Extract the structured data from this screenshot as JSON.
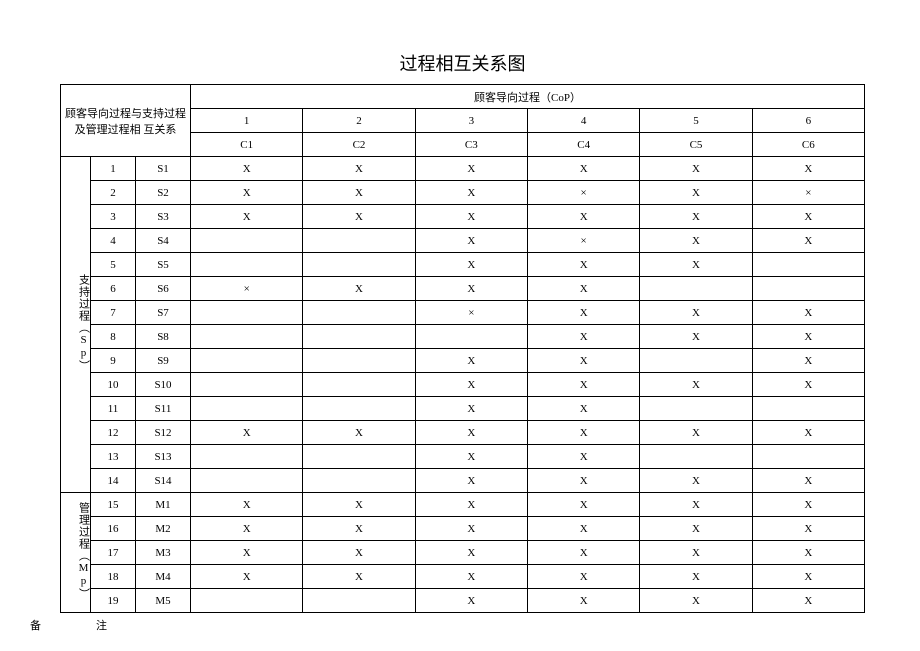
{
  "title": "过程相互关系图",
  "row_header": "顾客导向过程与支持过程及管理过程相\n互关系",
  "col_group_header": "顾客导向过程（CoP）",
  "columns": {
    "nums": [
      "1",
      "2",
      "3",
      "4",
      "5",
      "6"
    ],
    "codes": [
      "C1",
      "C2",
      "C3",
      "C4",
      "C5",
      "C6"
    ]
  },
  "groups": [
    {
      "label": "支持过程（Sp）",
      "start": 0,
      "count": 14
    },
    {
      "label": "管理过程（Mp）",
      "start": 14,
      "count": 5
    }
  ],
  "rows": [
    {
      "n": "1",
      "code": "S1",
      "c": [
        "X",
        "X",
        "X",
        "X",
        "X",
        "X"
      ]
    },
    {
      "n": "2",
      "code": "S2",
      "c": [
        "X",
        "X",
        "X",
        "×",
        "X",
        "×"
      ]
    },
    {
      "n": "3",
      "code": "S3",
      "c": [
        "X",
        "X",
        "X",
        "X",
        "X",
        "X"
      ]
    },
    {
      "n": "4",
      "code": "S4",
      "c": [
        "",
        "",
        "X",
        "×",
        "X",
        "X"
      ]
    },
    {
      "n": "5",
      "code": "S5",
      "c": [
        "",
        "",
        "X",
        "X",
        "X",
        ""
      ]
    },
    {
      "n": "6",
      "code": "S6",
      "c": [
        "×",
        "X",
        "X",
        "X",
        "",
        ""
      ]
    },
    {
      "n": "7",
      "code": "S7",
      "c": [
        "",
        "",
        "×",
        "X",
        "X",
        "X"
      ]
    },
    {
      "n": "8",
      "code": "S8",
      "c": [
        "",
        "",
        "",
        "X",
        "X",
        "X"
      ]
    },
    {
      "n": "9",
      "code": "S9",
      "c": [
        "",
        "",
        "X",
        "X",
        "",
        "X"
      ]
    },
    {
      "n": "10",
      "code": "S10",
      "c": [
        "",
        "",
        "X",
        "X",
        "X",
        "X"
      ]
    },
    {
      "n": "11",
      "code": "S11",
      "c": [
        "",
        "",
        "X",
        "X",
        "",
        ""
      ]
    },
    {
      "n": "12",
      "code": "S12",
      "c": [
        "X",
        "X",
        "X",
        "X",
        "X",
        "X"
      ]
    },
    {
      "n": "13",
      "code": "S13",
      "c": [
        "",
        "",
        "X",
        "X",
        "",
        ""
      ]
    },
    {
      "n": "14",
      "code": "S14",
      "c": [
        "",
        "",
        "X",
        "X",
        "X",
        "X"
      ]
    },
    {
      "n": "15",
      "code": "M1",
      "c": [
        "X",
        "X",
        "X",
        "X",
        "X",
        "X"
      ]
    },
    {
      "n": "16",
      "code": "M2",
      "c": [
        "X",
        "X",
        "X",
        "X",
        "X",
        "X"
      ]
    },
    {
      "n": "17",
      "code": "M3",
      "c": [
        "X",
        "X",
        "X",
        "X",
        "X",
        "X"
      ]
    },
    {
      "n": "18",
      "code": "M4",
      "c": [
        "X",
        "X",
        "X",
        "X",
        "X",
        "X"
      ]
    },
    {
      "n": "19",
      "code": "M5",
      "c": [
        "",
        "",
        "X",
        "X",
        "X",
        "X"
      ]
    }
  ],
  "footnote": {
    "l1": "备",
    "l2": "注"
  }
}
